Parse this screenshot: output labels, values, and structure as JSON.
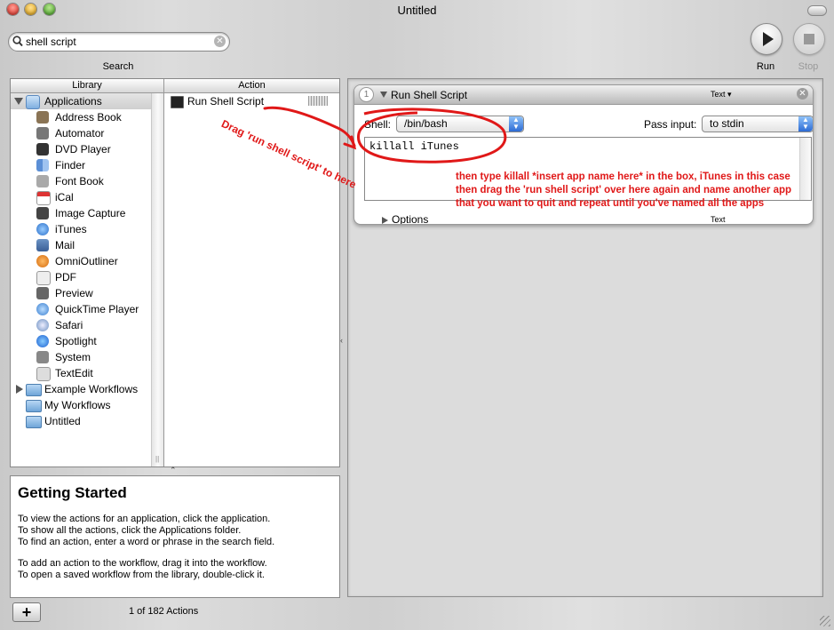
{
  "window": {
    "title": "Untitled"
  },
  "search": {
    "value": "shell script",
    "label": "Search"
  },
  "toolbar": {
    "run_label": "Run",
    "stop_label": "Stop"
  },
  "library": {
    "column_header": "Library",
    "items": [
      {
        "label": "Applications",
        "icon": "applications-folder-icon",
        "expanded": true
      },
      {
        "label": "Address Book",
        "icon": "address-book-icon"
      },
      {
        "label": "Automator",
        "icon": "automator-icon"
      },
      {
        "label": "DVD Player",
        "icon": "dvd-player-icon"
      },
      {
        "label": "Finder",
        "icon": "finder-icon"
      },
      {
        "label": "Font Book",
        "icon": "font-book-icon"
      },
      {
        "label": "iCal",
        "icon": "ical-icon"
      },
      {
        "label": "Image Capture",
        "icon": "image-capture-icon"
      },
      {
        "label": "iTunes",
        "icon": "itunes-icon"
      },
      {
        "label": "Mail",
        "icon": "mail-icon"
      },
      {
        "label": "OmniOutliner",
        "icon": "omnioutliner-icon"
      },
      {
        "label": "PDF",
        "icon": "pdf-icon"
      },
      {
        "label": "Preview",
        "icon": "preview-icon"
      },
      {
        "label": "QuickTime Player",
        "icon": "quicktime-icon"
      },
      {
        "label": "Safari",
        "icon": "safari-icon"
      },
      {
        "label": "Spotlight",
        "icon": "spotlight-icon"
      },
      {
        "label": "System",
        "icon": "system-icon"
      },
      {
        "label": "TextEdit",
        "icon": "textedit-icon"
      },
      {
        "label": "Example Workflows",
        "icon": "folder-icon"
      },
      {
        "label": "My Workflows",
        "icon": "folder-icon"
      },
      {
        "label": "Untitled",
        "icon": "folder-icon"
      }
    ]
  },
  "actions": {
    "column_header": "Action",
    "items": [
      {
        "label": "Run Shell Script",
        "icon": "terminal-icon"
      }
    ]
  },
  "info": {
    "title": "Getting Started",
    "lines": [
      "To view the actions for an application, click the application.",
      "To show all the actions, click the Applications folder.",
      "To find an action, enter a word or phrase in the search field.",
      "To add an action to the workflow, drag it into the workflow.",
      "To open a saved workflow from the library, double-click it."
    ]
  },
  "footer": {
    "add_label": "+",
    "count": "1 of 182 Actions"
  },
  "action_card": {
    "step": "1",
    "title": "Run Shell Script",
    "type_label": "Text ▾",
    "shell_label": "Shell:",
    "shell_value": "/bin/bash",
    "pass_input_label": "Pass input:",
    "pass_input_value": "to stdin",
    "script": "killall iTunes",
    "options_label": "Options",
    "output_label": "Text"
  },
  "annotations": {
    "drag_text": "Drag 'run shell script' to here",
    "instructions": [
      "then type killall *insert app name here* in the box, iTunes in this case",
      "then drag the 'run shell script' over here again and name another app",
      "that you want to quit and repeat until you've named all the apps"
    ],
    "color": "#e01818"
  }
}
